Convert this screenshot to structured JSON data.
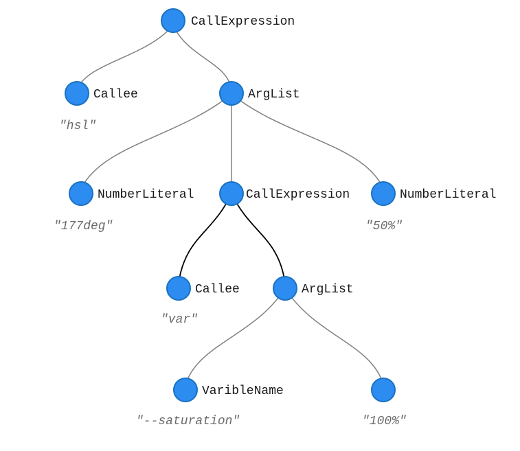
{
  "chart_data": {
    "type": "tree",
    "description": "Abstract syntax tree for CSS expression hsl(177deg, var(--saturation), 50%) with an extra 100% leaf",
    "nodes": [
      {
        "id": "root",
        "label": "CallExpression",
        "value": null
      },
      {
        "id": "callee1",
        "label": "Callee",
        "value": "\"hsl\""
      },
      {
        "id": "arglist1",
        "label": "ArgList",
        "value": null
      },
      {
        "id": "num1",
        "label": "NumberLiteral",
        "value": "\"177deg\""
      },
      {
        "id": "call2",
        "label": "CallExpression",
        "value": null
      },
      {
        "id": "num2",
        "label": "NumberLiteral",
        "value": "\"50%\""
      },
      {
        "id": "callee2",
        "label": "Callee",
        "value": "\"var\""
      },
      {
        "id": "arglist2",
        "label": "ArgList",
        "value": null
      },
      {
        "id": "varname",
        "label": "VaribleName",
        "value": "\"--saturation\""
      },
      {
        "id": "leaf100",
        "label": "",
        "value": "\"100%\""
      }
    ],
    "edges": [
      [
        "root",
        "callee1"
      ],
      [
        "root",
        "arglist1"
      ],
      [
        "arglist1",
        "num1"
      ],
      [
        "arglist1",
        "call2"
      ],
      [
        "arglist1",
        "num2"
      ],
      [
        "call2",
        "callee2"
      ],
      [
        "call2",
        "arglist2"
      ],
      [
        "arglist2",
        "varname"
      ],
      [
        "arglist2",
        "leaf100"
      ]
    ]
  },
  "nodes": {
    "root": {
      "label": "CallExpression"
    },
    "callee1": {
      "label": "Callee",
      "value": "\"hsl\""
    },
    "arglist1": {
      "label": "ArgList"
    },
    "num1": {
      "label": "NumberLiteral",
      "value": "\"177deg\""
    },
    "call2": {
      "label": "CallExpression"
    },
    "num2": {
      "label": "NumberLiteral",
      "value": "\"50%\""
    },
    "callee2": {
      "label": "Callee",
      "value": "\"var\""
    },
    "arglist2": {
      "label": "ArgList"
    },
    "varname": {
      "label": "VaribleName",
      "value": "\"--saturation\""
    },
    "leaf100": {
      "label": "",
      "value": "\"100%\""
    }
  }
}
